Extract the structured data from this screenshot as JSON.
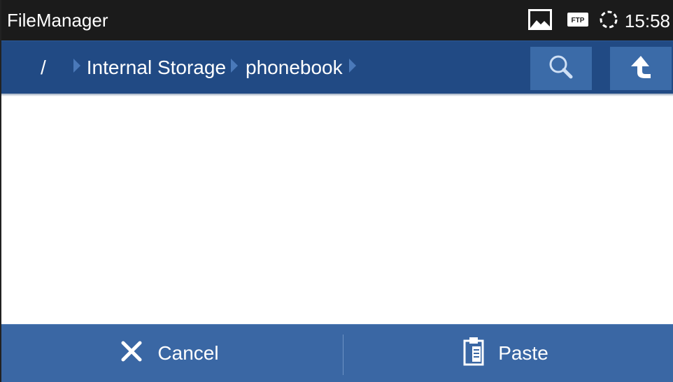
{
  "status_bar": {
    "app_title": "FileManager",
    "clock": "15:58",
    "icons": [
      "image-icon",
      "ftp-icon",
      "sync-icon"
    ],
    "ftp_label": "FTP"
  },
  "path_bar": {
    "crumbs": [
      {
        "label": "/"
      },
      {
        "label": "Internal Storage"
      },
      {
        "label": "phonebook"
      }
    ],
    "buttons": [
      "search-icon",
      "up-arrow-icon"
    ]
  },
  "action_bar": {
    "cancel_label": "Cancel",
    "paste_label": "Paste"
  },
  "colors": {
    "status_bar": "#1b1b1b",
    "path_bar": "#214a84",
    "tool_button": "#3b6ba8",
    "action_bar": "#3a67a4"
  }
}
